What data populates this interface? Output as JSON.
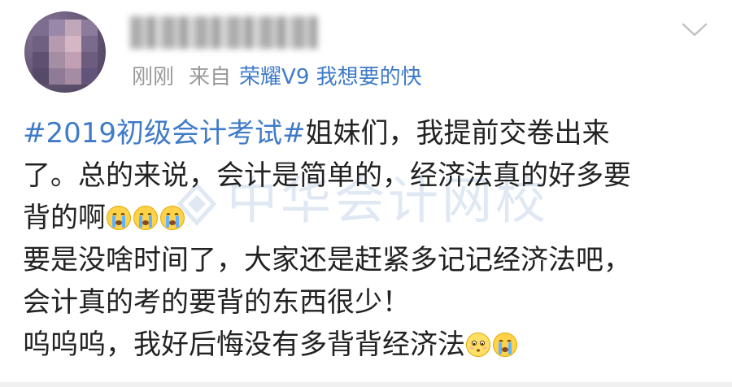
{
  "post": {
    "time": "刚刚",
    "source_prefix": "来自",
    "device": "荣耀V9 我想要的快",
    "lines": {
      "l1_tag": "#2019初级会计考试#",
      "l1_text": "姐妹们，我提前交卷出来",
      "l2": "了。总的来说，会计是简单的，经济法真的好多要",
      "l3": "背的啊",
      "l4": "要是没啥时间了，大家还是赶紧多记记经济法吧，",
      "l5": "会计真的考的要背的东西很少！",
      "l6": "呜呜呜，我好后悔没有多背背经济法"
    }
  },
  "watermark": {
    "text": "中华会计网校"
  },
  "icons": {
    "expand": "chevron-down-icon",
    "cry": "crying-emoji-icon",
    "sad": "sad-emoji-icon"
  },
  "colors": {
    "link": "#3f7bc8",
    "meta": "#9a9a9a",
    "text": "#222222",
    "watermark": "#dfe8f3"
  }
}
